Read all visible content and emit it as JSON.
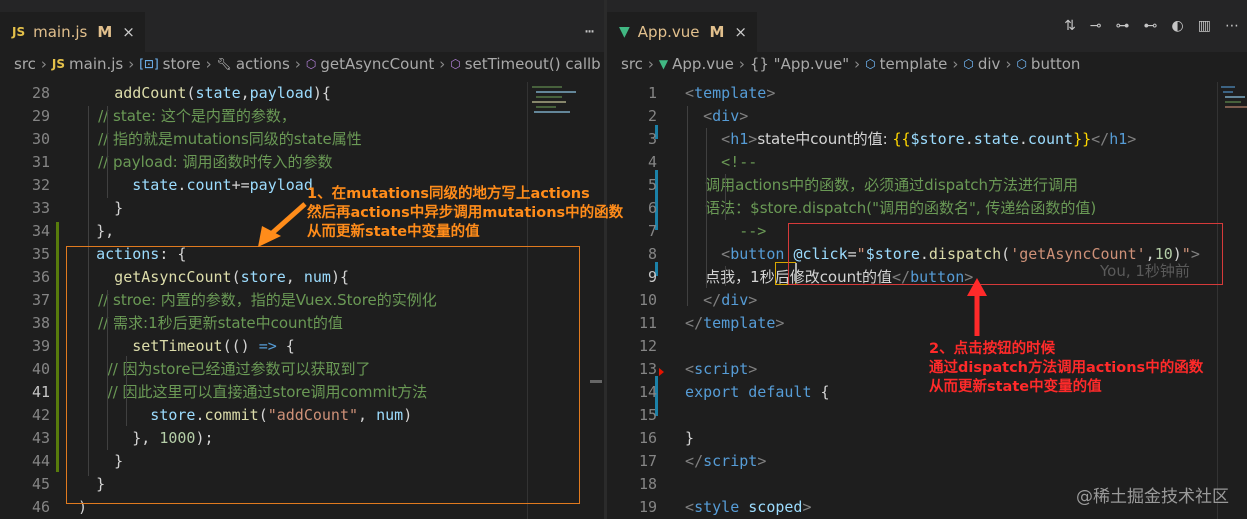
{
  "left": {
    "tab": {
      "icon_label": "JS",
      "title": "main.js",
      "status": "M"
    },
    "breadcrumb": [
      "src",
      "main.js",
      "store",
      "actions",
      "getAsyncCount",
      "setTimeout() callb"
    ],
    "lines": [
      {
        "n": "28",
        "tokens": [
          [
            "pun",
            "      "
          ],
          [
            "fn",
            "addCount"
          ],
          [
            "pun",
            "("
          ],
          [
            "var",
            "state"
          ],
          [
            "pun",
            ","
          ],
          [
            "var",
            "payload"
          ],
          [
            "pun",
            "){"
          ]
        ]
      },
      {
        "n": "29",
        "tokens": [
          [
            "com",
            "        // state: 这个是内置的参数，"
          ]
        ]
      },
      {
        "n": "30",
        "tokens": [
          [
            "com",
            "        // 指的就是mutations同级的state属性"
          ]
        ]
      },
      {
        "n": "31",
        "tokens": [
          [
            "com",
            "        // payload: 调用函数时传入的参数"
          ]
        ]
      },
      {
        "n": "32",
        "tokens": [
          [
            "var",
            "        state"
          ],
          [
            "pun",
            "."
          ],
          [
            "var",
            "count"
          ],
          [
            "pun",
            "+="
          ],
          [
            "var",
            "payload"
          ]
        ]
      },
      {
        "n": "33",
        "tokens": [
          [
            "pun",
            "      }"
          ]
        ]
      },
      {
        "n": "34",
        "tokens": [
          [
            "pun",
            "    },"
          ]
        ]
      },
      {
        "n": "35",
        "tokens": [
          [
            "var",
            "    actions"
          ],
          [
            "pun",
            ": {"
          ]
        ]
      },
      {
        "n": "36",
        "tokens": [
          [
            "fn",
            "      getAsyncCount"
          ],
          [
            "pun",
            "("
          ],
          [
            "var",
            "store"
          ],
          [
            "pun",
            ", "
          ],
          [
            "var",
            "num"
          ],
          [
            "pun",
            "){"
          ]
        ]
      },
      {
        "n": "37",
        "tokens": [
          [
            "com",
            "        // stroe: 内置的参数，指的是Vuex.Store的实例化"
          ]
        ]
      },
      {
        "n": "38",
        "tokens": [
          [
            "com",
            "        // 需求:1秒后更新state中count的值"
          ]
        ]
      },
      {
        "n": "39",
        "tokens": [
          [
            "fn",
            "        setTimeout"
          ],
          [
            "pun",
            "(() "
          ],
          [
            "kw",
            "=>"
          ],
          [
            "pun",
            " {"
          ]
        ]
      },
      {
        "n": "40",
        "tokens": [
          [
            "com",
            "          // 因为store已经通过参数可以获取到了"
          ]
        ]
      },
      {
        "n": "41",
        "tokens": [
          [
            "com",
            "          // 因此这里可以直接通过store调用commit方法"
          ]
        ]
      },
      {
        "n": "42",
        "tokens": [
          [
            "var",
            "          store"
          ],
          [
            "pun",
            "."
          ],
          [
            "fn",
            "commit"
          ],
          [
            "pun",
            "("
          ],
          [
            "str",
            "\"addCount\""
          ],
          [
            "pun",
            ", "
          ],
          [
            "var",
            "num"
          ],
          [
            "pun",
            ")"
          ]
        ]
      },
      {
        "n": "43",
        "tokens": [
          [
            "pun",
            "        }, "
          ],
          [
            "num",
            "1000"
          ],
          [
            "pun",
            ");"
          ]
        ]
      },
      {
        "n": "44",
        "tokens": [
          [
            "pun",
            "      }"
          ]
        ]
      },
      {
        "n": "45",
        "tokens": [
          [
            "pun",
            "    }"
          ]
        ]
      },
      {
        "n": "46",
        "tokens": [
          [
            "pun",
            "  )"
          ]
        ]
      }
    ],
    "annotation": [
      "1、在mutations同级的地方写上actions",
      "然后再actions中异步调用mutations中的函数",
      "从而更新state中变量的值"
    ]
  },
  "right": {
    "tab": {
      "title": "App.vue",
      "status": "M"
    },
    "breadcrumb": [
      "src",
      "App.vue",
      "{} \"App.vue\"",
      "template",
      "div",
      "button"
    ],
    "lines": [
      {
        "n": "1",
        "tokens": [
          [
            "tagb",
            "  <"
          ],
          [
            "tag",
            "template"
          ],
          [
            "tagb",
            ">"
          ]
        ]
      },
      {
        "n": "2",
        "tokens": [
          [
            "tagb",
            "    <"
          ],
          [
            "tag",
            "div"
          ],
          [
            "tagb",
            ">"
          ]
        ]
      },
      {
        "n": "3",
        "tokens": [
          [
            "tagb",
            "      <"
          ],
          [
            "tag",
            "h1"
          ],
          [
            "tagb",
            ">"
          ],
          [
            "pun",
            "state中count的值: "
          ],
          [
            "gold",
            "{{"
          ],
          [
            "var",
            "$store"
          ],
          [
            "pun",
            "."
          ],
          [
            "var",
            "state"
          ],
          [
            "pun",
            "."
          ],
          [
            "var",
            "count"
          ],
          [
            "gold",
            "}}"
          ],
          [
            "tagb",
            "</"
          ],
          [
            "tag",
            "h1"
          ],
          [
            "tagb",
            ">"
          ]
        ]
      },
      {
        "n": "4",
        "tokens": [
          [
            "com",
            "      <!--"
          ]
        ]
      },
      {
        "n": "5",
        "tokens": [
          [
            "com",
            "        调用actions中的函数，必须通过dispatch方法进行调用"
          ]
        ]
      },
      {
        "n": "6",
        "tokens": [
          [
            "com",
            "        语法：$store.dispatch(\"调用的函数名\", 传递给函数的值)"
          ]
        ]
      },
      {
        "n": "7",
        "tokens": [
          [
            "com",
            "        -->"
          ]
        ]
      },
      {
        "n": "8",
        "tokens": [
          [
            "tagb",
            "      <"
          ],
          [
            "tag",
            "button"
          ],
          [
            "pun",
            " "
          ],
          [
            "attr",
            "@click"
          ],
          [
            "pun",
            "="
          ],
          [
            "str",
            "\""
          ],
          [
            "var",
            "$store"
          ],
          [
            "pun",
            "."
          ],
          [
            "fn",
            "dispatch"
          ],
          [
            "pun",
            "("
          ],
          [
            "str",
            "'getAsyncCount'"
          ],
          [
            "pun",
            ","
          ],
          [
            "num",
            "10"
          ],
          [
            "pun",
            ")"
          ],
          [
            "str",
            "\""
          ],
          [
            "tagb",
            ">"
          ]
        ]
      },
      {
        "n": "9",
        "tokens": [
          [
            "pun",
            "        点我，1秒后修改count的值"
          ],
          [
            "tagb",
            "</"
          ],
          [
            "tag",
            "button"
          ],
          [
            "tagb",
            ">"
          ]
        ]
      },
      {
        "n": "10",
        "tokens": [
          [
            "tagb",
            "    </"
          ],
          [
            "tag",
            "div"
          ],
          [
            "tagb",
            ">"
          ]
        ]
      },
      {
        "n": "11",
        "tokens": [
          [
            "tagb",
            "  </"
          ],
          [
            "tag",
            "template"
          ],
          [
            "tagb",
            ">"
          ]
        ]
      },
      {
        "n": "12",
        "tokens": []
      },
      {
        "n": "13",
        "tokens": [
          [
            "tagb",
            "  <"
          ],
          [
            "tag",
            "script"
          ],
          [
            "tagb",
            ">"
          ]
        ]
      },
      {
        "n": "14",
        "tokens": [
          [
            "kw",
            "  export"
          ],
          [
            "pun",
            " "
          ],
          [
            "kw",
            "default"
          ],
          [
            "pun",
            " {"
          ]
        ]
      },
      {
        "n": "15",
        "tokens": []
      },
      {
        "n": "16",
        "tokens": [
          [
            "pun",
            "  }"
          ]
        ]
      },
      {
        "n": "17",
        "tokens": [
          [
            "tagb",
            "  </"
          ],
          [
            "tag",
            "script"
          ],
          [
            "tagb",
            ">"
          ]
        ]
      },
      {
        "n": "18",
        "tokens": []
      },
      {
        "n": "19",
        "tokens": [
          [
            "tagb",
            "  <"
          ],
          [
            "tag",
            "style"
          ],
          [
            "pun",
            " "
          ],
          [
            "attr",
            "scoped"
          ],
          [
            "tagb",
            ">"
          ]
        ]
      }
    ],
    "blame": "You, 1秒钟前",
    "annotation": [
      "2、点击按钮的时候",
      "通过dispatch方法调用actions中的函数",
      "从而更新state中变量的值"
    ]
  },
  "colors": {
    "annotation_orange": "#ff8c1a",
    "annotation_red": "#ff2a2a",
    "box_orange": "#e07a1f",
    "box_red": "#d63a3a"
  },
  "watermark": "@稀土掘金技术社区"
}
